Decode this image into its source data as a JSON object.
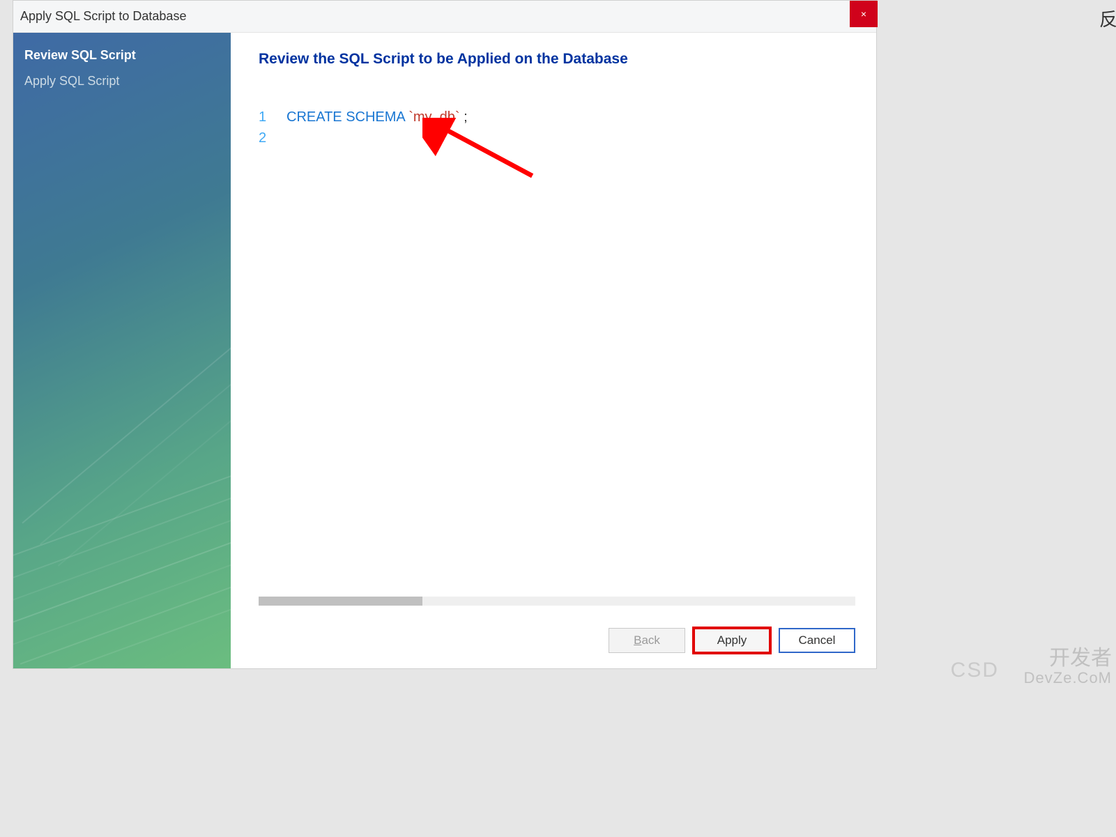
{
  "dialog": {
    "title": "Apply SQL Script to Database",
    "close_label": "×"
  },
  "sidebar": {
    "items": [
      {
        "label": "Review SQL Script",
        "active": true
      },
      {
        "label": "Apply SQL Script",
        "active": false
      }
    ]
  },
  "main": {
    "heading": "Review the SQL Script to be Applied on the Database",
    "code": {
      "lines": [
        {
          "num": "1",
          "tokens": [
            {
              "text": "CREATE SCHEMA ",
              "cls": "kw"
            },
            {
              "text": "`my_db`",
              "cls": "str"
            },
            {
              "text": " ;",
              "cls": "punct"
            }
          ]
        },
        {
          "num": "2",
          "tokens": []
        }
      ]
    }
  },
  "buttons": {
    "back": "Back",
    "apply": "Apply",
    "cancel": "Cancel"
  },
  "watermark": {
    "line1": "开发者",
    "line2": "DevZe.CoM",
    "csd": "CSD"
  },
  "partial_right": "反"
}
